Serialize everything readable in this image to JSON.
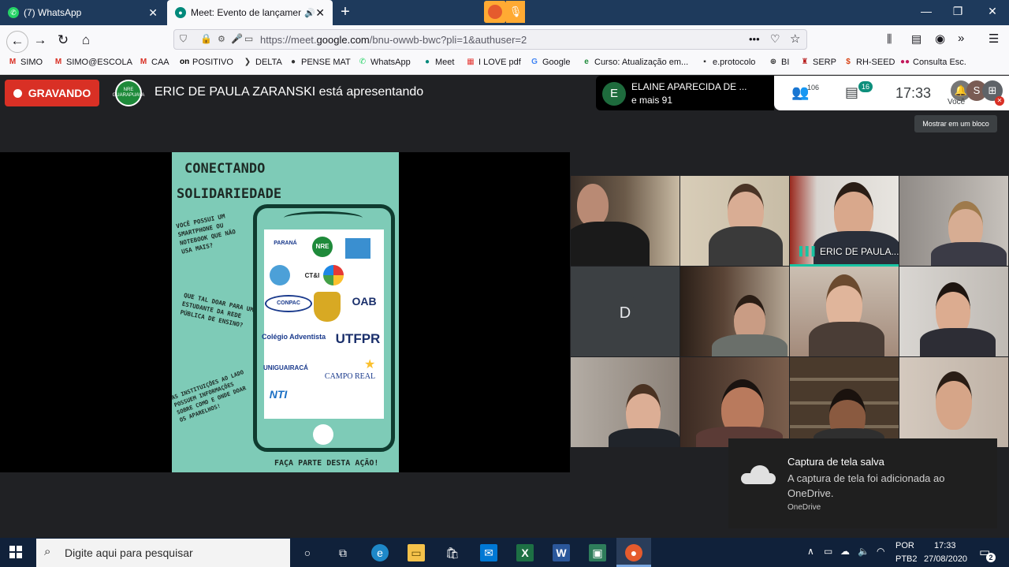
{
  "browser": {
    "tabs": [
      {
        "label": "(7) WhatsApp"
      },
      {
        "label": "Meet: Evento de lançament"
      }
    ],
    "url_prefix": "https://meet.",
    "url_domain": "google.com",
    "url_path": "/bnu-owwb-bwc?pli=1&authuser=2",
    "bookmarks": [
      "SIMO",
      "SIMO@ESCOLA",
      "CAA",
      "POSITIVO",
      "DELTA",
      "PENSE MAT",
      "WhatsApp",
      "Meet",
      "I LOVE pdf",
      "Google",
      "Curso: Atualização em...",
      "e.protocolo",
      "BI",
      "SERP",
      "RH-SEED",
      "Consulta Esc."
    ]
  },
  "meet": {
    "recording_label": "GRAVANDO",
    "nre_logo_text": "NRE GUARAPUAVA",
    "presenting_text": "ERIC DE PAULA ZARANSKI está apresentando",
    "pinned_initial": "E",
    "pinned_name": "ELAINE APARECIDA DE ...",
    "pinned_more": "e mais 91",
    "people_count": "106",
    "chat_count": "16",
    "clock": "17:33",
    "self_label": "Você",
    "self_initial": "S",
    "tooltip": "Mostrar em um bloco",
    "speaker_label": "ERIC DE PAULA...",
    "avatar_initial": "D"
  },
  "poster": {
    "title1": "CONECTANDO",
    "title2": "SOLIDARIEDADE",
    "q1": "VOCÊ POSSUI UM SMARTPHONE OU NOTEBOOK QUE NÃO USA MAIS?",
    "q2": "QUE TAL DOAR PARA UM ESTUDANTE DA REDE PÚBLICA DE ENSINO?",
    "q3": "AS INSTITUIÇÕES AO LADO POSSUEM INFORMAÇÕES SOBRE COMO E ONDE DOAR OS APARELHOS!",
    "footer": "FAÇA PARTE DESTA AÇÃO!",
    "logos": [
      "PARANÁ",
      "NRE",
      "CT&I",
      "CONPAC",
      "OAB",
      "Colégio Adventista",
      "UTFPR",
      "UNIGUAIRACÁ",
      "CAMPO REAL",
      "NTI"
    ]
  },
  "toast": {
    "title": "Captura de tela salva",
    "message": "A captura de tela foi adicionada ao OneDrive.",
    "source": "OneDrive"
  },
  "taskbar": {
    "search_placeholder": "Digite aqui para pesquisar",
    "lang1": "POR",
    "lang2": "PTB2",
    "time": "17:33",
    "date": "27/08/2020",
    "notifications": "2"
  },
  "colors": {
    "record_red": "#d93025",
    "poster_teal": "#7ecbb7",
    "speaking_green": "#19c4a2"
  }
}
